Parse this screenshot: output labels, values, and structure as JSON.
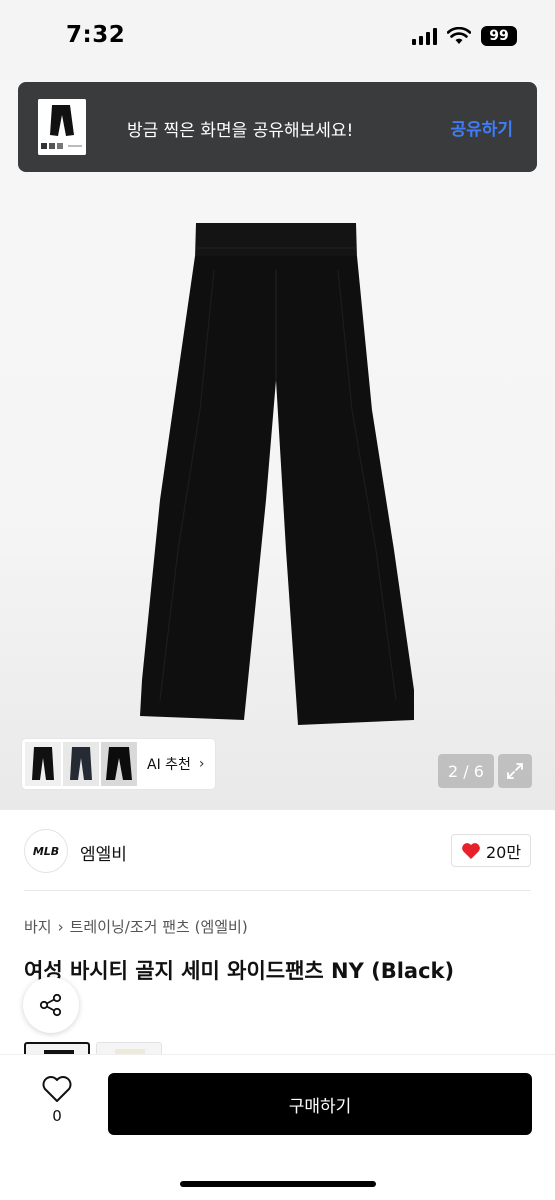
{
  "status": {
    "time": "7:32",
    "battery": "99"
  },
  "toast": {
    "message": "방금 찍은 화면을 공유해보세요!",
    "action": "공유하기"
  },
  "gallery": {
    "ai_label": "AI 추천",
    "counter": "2 / 6"
  },
  "brand": {
    "logo_text": "MLB",
    "name": "엠엘비",
    "likes": "20만"
  },
  "breadcrumb": {
    "items": [
      "바지",
      "트레이닝/조거 팬츠 (엠엘비)"
    ]
  },
  "product": {
    "title": "여성 바시티 골지 세미 와이드팬츠 NY (Black)"
  },
  "bottom_bar": {
    "wish_count": "0",
    "buy_label": "구매하기"
  },
  "colors": {
    "accent_link": "#3f7cf6",
    "heart": "#e8202a"
  }
}
